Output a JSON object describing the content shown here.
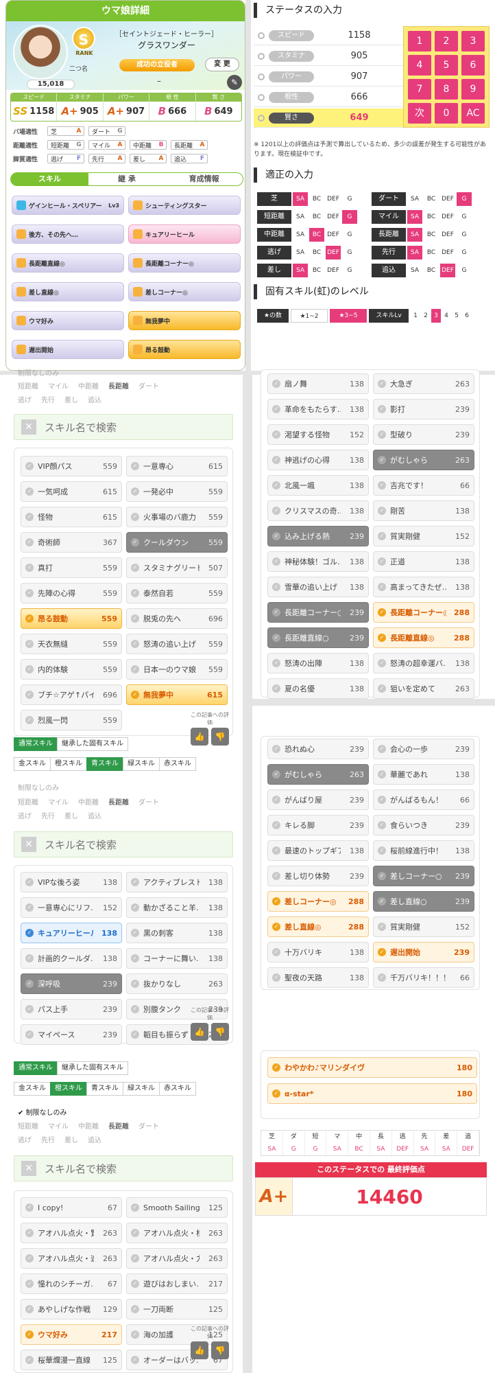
{
  "card": {
    "title": "ウマ娘詳細",
    "rank_letter": "S",
    "rank_word": "RANK",
    "futatsuna": "二つ名",
    "epithet": "［セイントジェード・ヒーラー］",
    "name": "グラスワンダー",
    "rank_pill": "成功の立役者",
    "change": "変 更",
    "score": "15,018",
    "dash": "–"
  },
  "stats": [
    {
      "label": "スピード",
      "rank": "SS",
      "value": "1158"
    },
    {
      "label": "スタミナ",
      "rank": "A+",
      "value": "905"
    },
    {
      "label": "パワー",
      "rank": "A+",
      "value": "907"
    },
    {
      "label": "根 性",
      "rank": "B",
      "value": "666"
    },
    {
      "label": "賢 さ",
      "rank": "B",
      "value": "649"
    }
  ],
  "aptitude": {
    "field": {
      "label": "バ場適性",
      "items": [
        [
          "芝",
          "A"
        ],
        [
          "ダート",
          "G"
        ]
      ]
    },
    "distance": {
      "label": "距離適性",
      "items": [
        [
          "短距離",
          "G"
        ],
        [
          "マイル",
          "A"
        ],
        [
          "中距離",
          "B"
        ],
        [
          "長距離",
          "A"
        ]
      ]
    },
    "style": {
      "label": "脚質適性",
      "items": [
        [
          "逃げ",
          "F"
        ],
        [
          "先行",
          "A"
        ],
        [
          "差し",
          "A"
        ],
        [
          "追込",
          "F"
        ]
      ]
    }
  },
  "card_tabs": [
    "スキル",
    "継 承",
    "育成情報"
  ],
  "card_skills": [
    {
      "name": "ゲインヒール・スペリアー",
      "lv": "Lv3"
    },
    {
      "name": "シューティングスター",
      "lv": ""
    },
    {
      "name": "後方、その先へ…",
      "lv": ""
    },
    {
      "name": "キュアリーヒール",
      "lv": ""
    },
    {
      "name": "長距離直線◎",
      "lv": ""
    },
    {
      "name": "長距離コーナー◎",
      "lv": ""
    },
    {
      "name": "差し直線◎",
      "lv": ""
    },
    {
      "name": "差しコーナー◎",
      "lv": ""
    },
    {
      "name": "ウマ好み",
      "lv": ""
    },
    {
      "name": "無我夢中",
      "lv": ""
    },
    {
      "name": "遅出開始",
      "lv": ""
    },
    {
      "name": "昂る鼓動",
      "lv": ""
    }
  ],
  "status_input": {
    "title": "ステータスの入力",
    "rows": [
      [
        "スピード",
        "1158"
      ],
      [
        "スタミナ",
        "905"
      ],
      [
        "パワー",
        "907"
      ],
      [
        "根性",
        "666"
      ],
      [
        "賢さ",
        "649"
      ]
    ],
    "keys": [
      "1",
      "2",
      "3",
      "4",
      "5",
      "6",
      "7",
      "8",
      "9",
      "次",
      "0",
      "AC"
    ],
    "note": "※ 1201以上の評価点は予測で算出しているため、多少の誤差が発生する可能性があります。現在検証中です。"
  },
  "adapt_input": {
    "title": "適正の入力",
    "opts": [
      "SA",
      "BC",
      "DEF",
      "G"
    ],
    "rows": [
      {
        "label": "芝",
        "sel": 0
      },
      {
        "label": "ダート",
        "sel": 3
      },
      {
        "label": "短距離",
        "sel": 3
      },
      {
        "label": "マイル",
        "sel": 0
      },
      {
        "label": "中距離",
        "sel": 1
      },
      {
        "label": "長距離",
        "sel": 0
      },
      {
        "label": "逃げ",
        "sel": 2
      },
      {
        "label": "先行",
        "sel": 0
      },
      {
        "label": "差し",
        "sel": 0
      },
      {
        "label": "追込",
        "sel": 2
      }
    ]
  },
  "level": {
    "title": "固有スキル(虹)のレベル",
    "stars_label": "★の数",
    "star1": "★1~2",
    "star2": "★3~5",
    "lv_label": "スキルLv",
    "lvs": [
      "1",
      "2",
      "3",
      "4",
      "5",
      "6"
    ]
  },
  "filters": {
    "restrict": "制限なしのみ",
    "dist": [
      "短距離",
      "マイル",
      "中距離",
      "長距離",
      "ダート"
    ],
    "style": [
      "逃げ",
      "先行",
      "差し",
      "追込"
    ],
    "search": "スキル名で検索"
  },
  "tabs_main": [
    "通常スキル",
    "継承した固有スキル"
  ],
  "tabs_color": [
    "金スキル",
    "橙スキル",
    "青スキル",
    "緑スキル",
    "赤スキル"
  ],
  "eval": "この記事への評価",
  "list1": [
    [
      "VIP顔パス",
      "559"
    ],
    [
      "一意専心",
      "615"
    ],
    [
      "一気呵成",
      "615"
    ],
    [
      "一発必中",
      "559"
    ],
    [
      "怪物",
      "615"
    ],
    [
      "火事場のバ鹿力",
      "559"
    ],
    [
      "奇術師",
      "367"
    ],
    [
      "クールダウン",
      "559"
    ],
    [
      "真打",
      "559"
    ],
    [
      "スタミナグリード",
      "507"
    ],
    [
      "先陣の心得",
      "559"
    ],
    [
      "泰然自若",
      "559"
    ],
    [
      "昂る鼓動",
      "559"
    ],
    [
      "脱兎の先へ",
      "696"
    ],
    [
      "天衣無縫",
      "559"
    ],
    [
      "怒涛の追い上げ",
      "559"
    ],
    [
      "内的体験",
      "559"
    ],
    [
      "日本一のウマ娘",
      "559"
    ],
    [
      "ブチ☆アゲ↑パイ…",
      "696"
    ],
    [
      "無我夢中",
      "615"
    ],
    [
      "烈風一閃",
      "559"
    ]
  ],
  "list2": [
    [
      "VIPな後ろ姿",
      "138"
    ],
    [
      "アクティブレスト",
      "138"
    ],
    [
      "一意専心にリフ…",
      "152"
    ],
    [
      "動かざること羊…",
      "138"
    ],
    [
      "キュアリーヒール",
      "138"
    ],
    [
      "黒の刺客",
      "138"
    ],
    [
      "計画的クールダ…",
      "138"
    ],
    [
      "コーナーに舞い…",
      "138"
    ],
    [
      "深呼吸",
      "239"
    ],
    [
      "抜かりなし",
      "263"
    ],
    [
      "パス上手",
      "239"
    ],
    [
      "別腹タンク",
      "239"
    ],
    [
      "マイペース",
      "239"
    ],
    [
      "韜目も振らず",
      "239"
    ]
  ],
  "list3": [
    [
      "I copy!",
      "67"
    ],
    [
      "Smooth Sailing!",
      "125"
    ],
    [
      "アオハル点火・賢",
      "263"
    ],
    [
      "アオハル点火・根",
      "263"
    ],
    [
      "アオハル点火・速",
      "263"
    ],
    [
      "アオハル点火・力",
      "263"
    ],
    [
      "憧れのシチーガ…",
      "67"
    ],
    [
      "遊びはおしまい…",
      "217"
    ],
    [
      "あやしげな作戦",
      "129"
    ],
    [
      "一刀両断",
      "125"
    ],
    [
      "ウマ好み",
      "217"
    ],
    [
      "海の加護",
      "125"
    ],
    [
      "桜華爛漫一直線",
      "125"
    ],
    [
      "オーダーはバッ…",
      "67"
    ]
  ],
  "list4": [
    [
      "扇ノ舞",
      "138"
    ],
    [
      "大急ぎ",
      "263"
    ],
    [
      "革命をもたらす…",
      "138"
    ],
    [
      "影打",
      "239"
    ],
    [
      "渇望する怪物",
      "152"
    ],
    [
      "型破り",
      "239"
    ],
    [
      "神逃げの心得",
      "138"
    ],
    [
      "がむしゃら",
      "263"
    ],
    [
      "北風一颯",
      "138"
    ],
    [
      "吉兆です！",
      "66"
    ],
    [
      "クリスマスの奇…",
      "138"
    ],
    [
      "剛苦",
      "138"
    ],
    [
      "込み上げる熱",
      "239"
    ],
    [
      "質実剛健",
      "152"
    ],
    [
      "神秘体験！ゴル…",
      "138"
    ],
    [
      "正道",
      "138"
    ],
    [
      "雪華の追い上げ",
      "138"
    ],
    [
      "高まってきたぜ…",
      "138"
    ],
    [
      "長距離コーナー○",
      "239"
    ],
    [
      "長距離コーナー◎",
      "288"
    ],
    [
      "長距離直線○",
      "239"
    ],
    [
      "長距離直線◎",
      "288"
    ],
    [
      "怒涛の出陣",
      "138"
    ],
    [
      "怒涛の超幸運バ…",
      "138"
    ],
    [
      "夏の名優",
      "138"
    ],
    [
      "狙いを定めて",
      "263"
    ]
  ],
  "list5": [
    [
      "恐れぬ心",
      "239"
    ],
    [
      "会心の一歩",
      "239"
    ],
    [
      "がむしゃら",
      "263"
    ],
    [
      "華麗であれ",
      "138"
    ],
    [
      "がんばり屋",
      "239"
    ],
    [
      "がんばるもん！",
      "66"
    ],
    [
      "キレる脚",
      "239"
    ],
    [
      "食らいつき",
      "239"
    ],
    [
      "最速のトップギア",
      "138"
    ],
    [
      "桜前線進行中！",
      "138"
    ],
    [
      "差し切り体勢",
      "239"
    ],
    [
      "差しコーナー○",
      "239"
    ],
    [
      "差しコーナー◎",
      "288"
    ],
    [
      "差し直線○",
      "239"
    ],
    [
      "差し直線◎",
      "288"
    ],
    [
      "質実剛健",
      "152"
    ],
    [
      "十万バリキ",
      "138"
    ],
    [
      "遅出開始",
      "239"
    ],
    [
      "聖夜の天路",
      "138"
    ],
    [
      "千万バリキ！！！",
      "66"
    ]
  ],
  "list6": [
    [
      "わやかわ♪マリンダイヴ",
      "180"
    ],
    [
      "α-star*",
      "180"
    ]
  ],
  "grade_table": {
    "heads": [
      "芝",
      "ダ",
      "短",
      "マ",
      "中",
      "長",
      "逃",
      "先",
      "差",
      "追"
    ],
    "vals": [
      "SA",
      "G",
      "G",
      "SA",
      "BC",
      "SA",
      "DEF",
      "SA",
      "SA",
      "DEF"
    ]
  },
  "final": {
    "label": "このステータスでの 最終評価点",
    "rank": "A+",
    "score": "14460"
  }
}
